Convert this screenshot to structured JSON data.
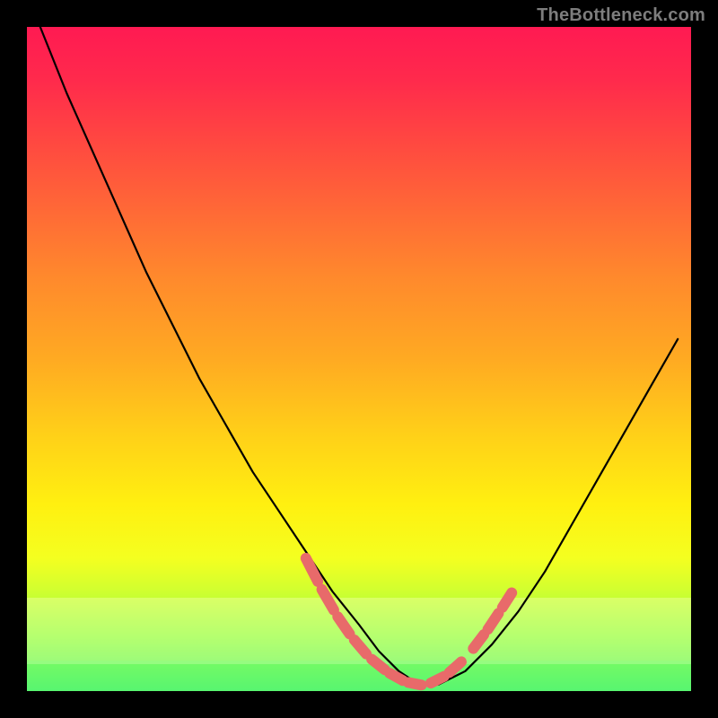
{
  "attribution": "TheBottleneck.com",
  "colors": {
    "background": "#000000",
    "curve": "#000000",
    "marker_fill": "#e86a6a",
    "marker_stroke": "#c94f4f",
    "gradient_top": "#ff1a52",
    "gradient_mid": "#ffaa22",
    "gradient_bottom": "#3cf062"
  },
  "chart_data": {
    "type": "line",
    "title": "",
    "xlabel": "",
    "ylabel": "",
    "xlim": [
      0,
      100
    ],
    "ylim": [
      0,
      100
    ],
    "grid": false,
    "legend": false,
    "series": [
      {
        "name": "bottleneck-curve",
        "x": [
          2,
          6,
          10,
          14,
          18,
          22,
          26,
          30,
          34,
          38,
          42,
          46,
          50,
          53,
          56,
          59,
          62,
          66,
          70,
          74,
          78,
          82,
          86,
          90,
          94,
          98
        ],
        "values": [
          100,
          90,
          81,
          72,
          63,
          55,
          47,
          40,
          33,
          27,
          21,
          15,
          10,
          6,
          3,
          1,
          1,
          3,
          7,
          12,
          18,
          25,
          32,
          39,
          46,
          53
        ]
      }
    ],
    "markers": {
      "name": "highlight-dashes",
      "segments": [
        {
          "x1": 42.0,
          "y1": 20.0,
          "x2": 43.8,
          "y2": 16.5
        },
        {
          "x1": 44.4,
          "y1": 15.3,
          "x2": 46.2,
          "y2": 12.2
        },
        {
          "x1": 46.8,
          "y1": 11.2,
          "x2": 48.6,
          "y2": 8.6
        },
        {
          "x1": 49.3,
          "y1": 7.7,
          "x2": 51.1,
          "y2": 5.6
        },
        {
          "x1": 51.9,
          "y1": 4.8,
          "x2": 53.9,
          "y2": 3.2
        },
        {
          "x1": 54.6,
          "y1": 2.7,
          "x2": 56.6,
          "y2": 1.6
        },
        {
          "x1": 57.4,
          "y1": 1.3,
          "x2": 59.4,
          "y2": 0.9
        },
        {
          "x1": 60.8,
          "y1": 1.2,
          "x2": 62.8,
          "y2": 2.2
        },
        {
          "x1": 63.6,
          "y1": 2.8,
          "x2": 65.4,
          "y2": 4.4
        },
        {
          "x1": 67.2,
          "y1": 6.4,
          "x2": 68.8,
          "y2": 8.5
        },
        {
          "x1": 69.4,
          "y1": 9.3,
          "x2": 71.0,
          "y2": 11.7
        },
        {
          "x1": 71.6,
          "y1": 12.6,
          "x2": 73.0,
          "y2": 14.8
        }
      ]
    }
  }
}
